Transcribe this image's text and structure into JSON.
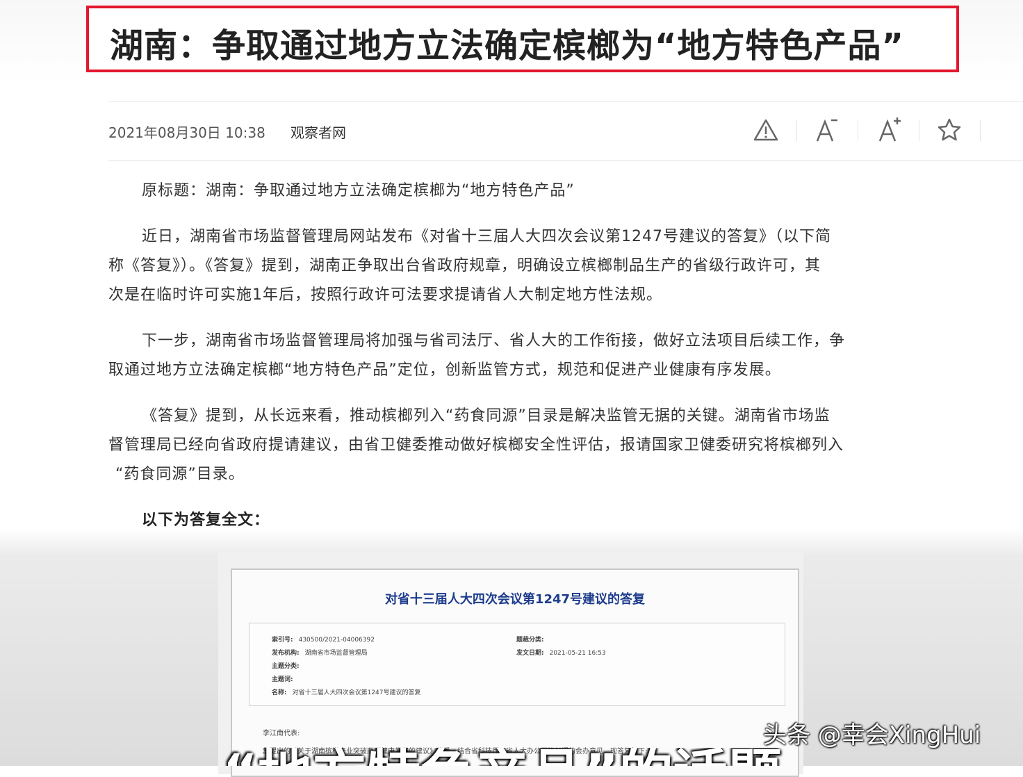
{
  "headline": "湖南：争取通过地方立法确定槟榔为“地方特色产品”",
  "meta": {
    "datetime": "2021年08月30日 10:38",
    "source": "观察者网"
  },
  "toolbar": {
    "icons": [
      "warning-icon",
      "font-decrease-icon",
      "font-increase-icon",
      "star-icon"
    ]
  },
  "article": {
    "original_title": "原标题：湖南：争取通过地方立法确定槟榔为“地方特色产品”",
    "p1_line1": "近日，湖南省市场监督管理局网站发布《对省十三届人大四次会议第1247号建议的答复》（以下简",
    "p1_line2": "称《答复》）。《答复》提到，湖南正争取出台省政府规章，明确设立槟榔制品生产的省级行政许可，其",
    "p1_line3": "次是在临时许可实施1年后，按照行政许可法要求提请省人大制定地方性法规。",
    "p2_line1": "下一步，湖南省市场监督管理局将加强与省司法厅、省人大的工作衔接，做好立法项目后续工作，争",
    "p2_line2": "取通过地方立法确定槟榔“地方特色产品”定位，创新监管方式，规范和促进产业健康有序发展。",
    "p3_line1": "《答复》提到，从长远来看，推动槟榔列入“药食同源”目录是解决监管无据的关键。湖南省市场监",
    "p3_line2": "督管理局已经向省政府提请建议，由省卫健委推动做好槟榔安全性评估，报请国家卫健委研究将槟榔列入",
    "p3_line3": "“药食同源”目录。",
    "full_text_label": "以下为答复全文："
  },
  "document": {
    "title": "对省十三届人大四次会议第1247号建议的答复",
    "index_label": "索引号:",
    "index_value": "430500/2021-04006392",
    "publisher_label": "发布机构:",
    "publisher_value": "湖南省市场监督管理局",
    "topic_label": "主题分类:",
    "keyword_label": "主题词:",
    "name_label": "名称:",
    "name_value": "对省十三届人大四次会议第1247号建议的答复",
    "category_label": "题裁分类:",
    "date_label": "发文日期:",
    "date_value": "2021-05-21 16:53",
    "salutation": "李江南代表:",
    "body_line": "您提出的《关于湖南槟榔产业突破瓶颈健康发展的建议》收悉。结合省科技厅、省人大办公厅等部门的会办意见，现答复如下:"
  },
  "watermark": "头条 @幸会XingHui",
  "subtitle_fragment": "“地方特色产品”的话题"
}
